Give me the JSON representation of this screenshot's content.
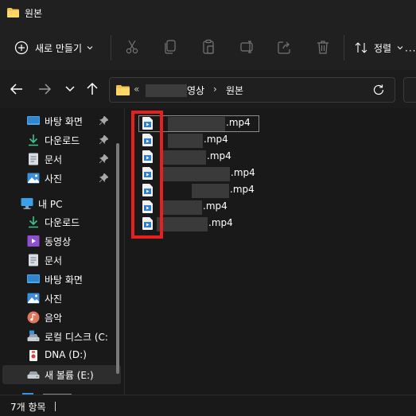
{
  "window": {
    "title": "원본"
  },
  "toolbar": {
    "new_label": "새로 만들기",
    "sort_label": "정렬",
    "more_label": "···",
    "icons": [
      "cut-icon",
      "copy-icon",
      "paste-icon",
      "rename-icon",
      "share-icon",
      "delete-icon"
    ]
  },
  "address": {
    "overflow": "«",
    "crumbs": [
      "영상",
      "원본"
    ],
    "separator": "›"
  },
  "sidebar": {
    "quick_access": [
      {
        "label": "바탕 화면",
        "icon": "desktop-icon",
        "pinned": true
      },
      {
        "label": "다운로드",
        "icon": "download-icon",
        "pinned": true
      },
      {
        "label": "문서",
        "icon": "document-icon",
        "pinned": true
      },
      {
        "label": "사진",
        "icon": "pictures-icon",
        "pinned": true
      }
    ],
    "this_pc": {
      "label": "내 PC",
      "icon": "monitor-icon"
    },
    "pc_items": [
      {
        "label": "다운로드",
        "icon": "download-icon"
      },
      {
        "label": "동영상",
        "icon": "videos-icon"
      },
      {
        "label": "문서",
        "icon": "document-icon"
      },
      {
        "label": "바탕 화면",
        "icon": "desktop-icon"
      },
      {
        "label": "사진",
        "icon": "pictures-icon"
      },
      {
        "label": "음악",
        "icon": "music-icon"
      },
      {
        "label": "로컬 디스크 (C:",
        "icon": "local-disk-icon"
      },
      {
        "label": "DNA (D:)",
        "icon": "usb-drive-icon"
      },
      {
        "label": "새 볼륨 (E:)",
        "icon": "drive-icon",
        "selected": true
      }
    ]
  },
  "files": [
    {
      "ext": ".mp4",
      "focused": true
    },
    {
      "ext": ".mp4"
    },
    {
      "ext": ".mp4"
    },
    {
      "ext": ".mp4"
    },
    {
      "ext": ".mp4"
    },
    {
      "ext": ".mp4"
    },
    {
      "ext": ".mp4"
    }
  ],
  "status": {
    "item_count": "7개 항목"
  },
  "colors": {
    "highlight": "#e81f1f",
    "folder": "#f4c24a",
    "accent": "#4cc2ff"
  }
}
